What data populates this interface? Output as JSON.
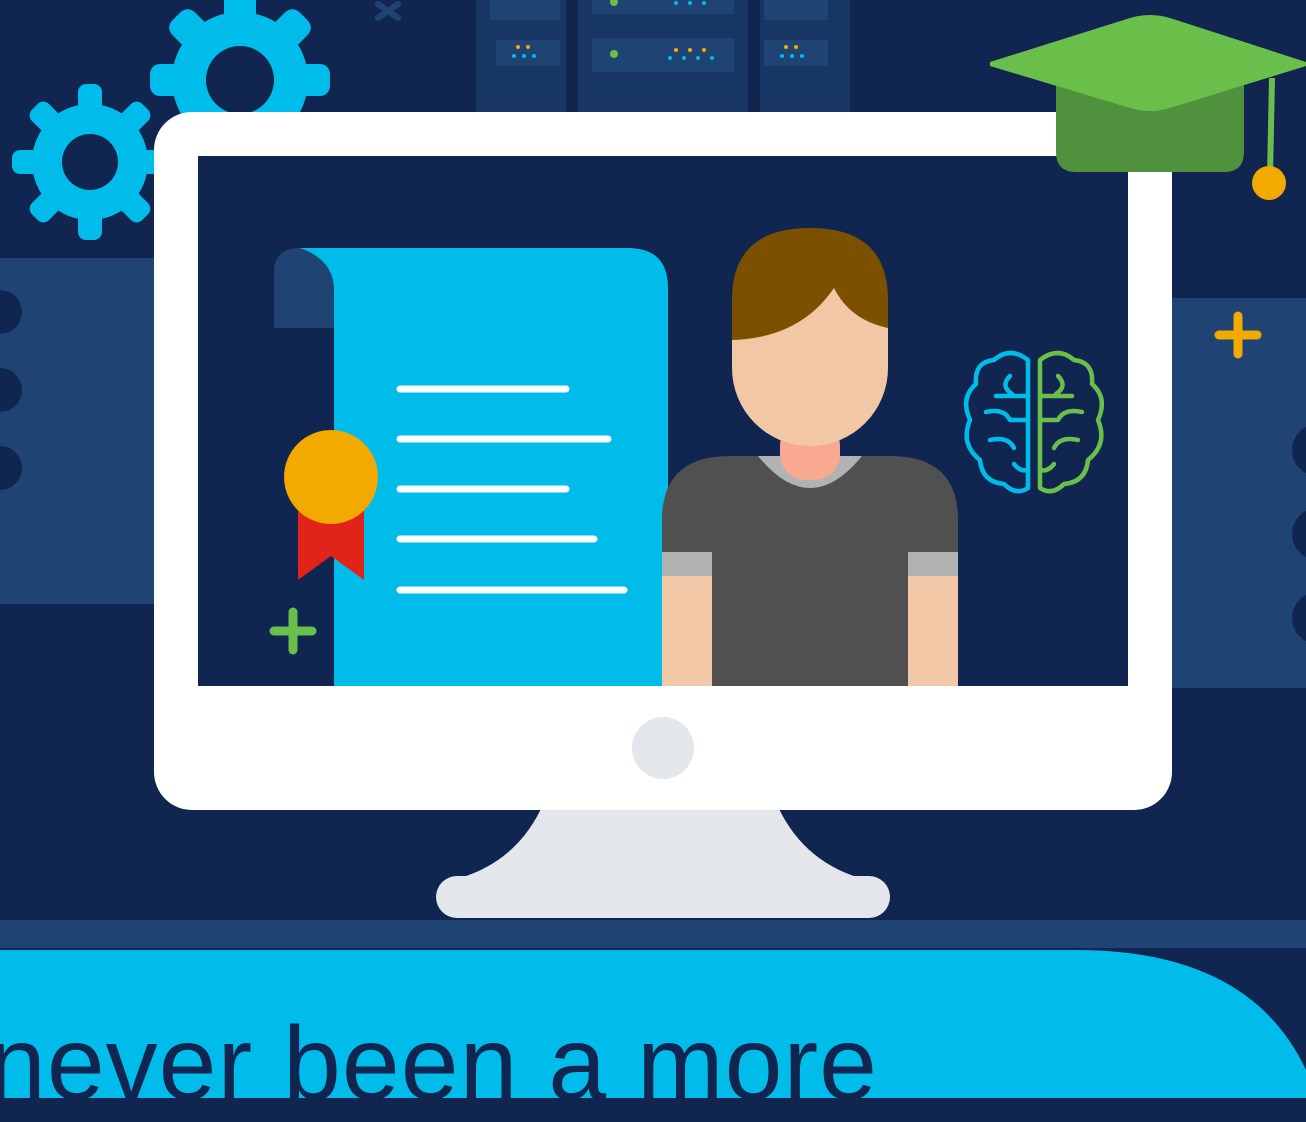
{
  "banner": {
    "headline": "never been a more"
  },
  "colors": {
    "background": "#102650",
    "panel": "#1f4373",
    "accent_blue": "#00bceb",
    "graduation_green": "#6abf4b",
    "seal_orange": "#f2a900",
    "ribbon_red": "#e2231a",
    "shirt_gray": "#505050",
    "hair_brown": "#7b5100",
    "skin": "#f2c7a6"
  },
  "icons": [
    "gear-icon",
    "server-rack-icon",
    "monitor-icon",
    "certificate-icon",
    "award-seal-icon",
    "person-avatar-icon",
    "brain-icon",
    "graduation-cap-icon",
    "plus-icon"
  ]
}
